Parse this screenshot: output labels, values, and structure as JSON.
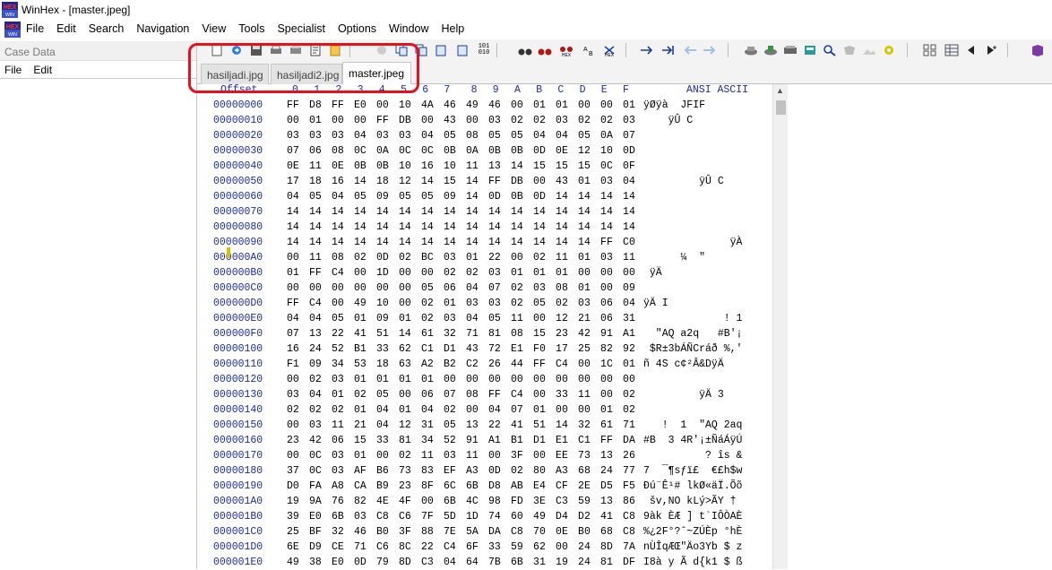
{
  "window": {
    "title": "WinHex - [master.jpeg]"
  },
  "menu": [
    "File",
    "Edit",
    "Search",
    "Navigation",
    "View",
    "Tools",
    "Specialist",
    "Options",
    "Window",
    "Help"
  ],
  "case_panel": {
    "header": "Case Data",
    "submenu": [
      "File",
      "Edit"
    ]
  },
  "tabs": [
    {
      "label": "hasiljadi.jpg",
      "active": false
    },
    {
      "label": "hasiljadi2.jpg",
      "active": false
    },
    {
      "label": "master.jpeg",
      "active": true
    }
  ],
  "hex_header": {
    "offset": "Offset",
    "columns": [
      "0",
      "1",
      "2",
      "3",
      "4",
      "5",
      "6",
      "7",
      "8",
      "9",
      "A",
      "B",
      "C",
      "D",
      "E",
      "F"
    ],
    "ascii": "ANSI ASCII"
  },
  "colors": {
    "offset_text": "#1a2bb8",
    "highlight": "#e8101c"
  },
  "rows": [
    {
      "offset": "00000000",
      "bytes": "FF D8 FF E0 00 10 4A 46 49 46 00 01 01 00 00 01",
      "ascii": "ÿØÿà  JFIF"
    },
    {
      "offset": "00000010",
      "bytes": "00 01 00 00 FF DB 00 43 00 03 02 02 03 02 02 03",
      "ascii": "    ÿÛ C"
    },
    {
      "offset": "00000020",
      "bytes": "03 03 03 04 03 03 04 05 08 05 05 04 04 05 0A 07",
      "ascii": ""
    },
    {
      "offset": "00000030",
      "bytes": "07 06 08 0C 0A 0C 0C 0B 0A 0B 0B 0D 0E 12 10 0D",
      "ascii": ""
    },
    {
      "offset": "00000040",
      "bytes": "0E 11 0E 0B 0B 10 16 10 11 13 14 15 15 15 0C 0F",
      "ascii": ""
    },
    {
      "offset": "00000050",
      "bytes": "17 18 16 14 18 12 14 15 14 FF DB 00 43 01 03 04",
      "ascii": "         ÿÛ C"
    },
    {
      "offset": "00000060",
      "bytes": "04 05 04 05 09 05 05 09 14 0D 0B 0D 14 14 14 14",
      "ascii": ""
    },
    {
      "offset": "00000070",
      "bytes": "14 14 14 14 14 14 14 14 14 14 14 14 14 14 14 14",
      "ascii": ""
    },
    {
      "offset": "00000080",
      "bytes": "14 14 14 14 14 14 14 14 14 14 14 14 14 14 14 14",
      "ascii": ""
    },
    {
      "offset": "00000090",
      "bytes": "14 14 14 14 14 14 14 14 14 14 14 14 14 14 FF C0",
      "ascii": "              ÿÀ"
    },
    {
      "offset": "000000A0",
      "bytes": "00 11 08 02 0D 02 BC 03 01 22 00 02 11 01 03 11",
      "ascii": "      ¼  \""
    },
    {
      "offset": "000000B0",
      "bytes": "01 FF C4 00 1D 00 00 02 02 03 01 01 01 00 00 00",
      "ascii": " ÿÄ"
    },
    {
      "offset": "000000C0",
      "bytes": "00 00 00 00 00 00 05 06 04 07 02 03 08 01 00 09",
      "ascii": ""
    },
    {
      "offset": "000000D0",
      "bytes": "FF C4 00 49 10 00 02 01 03 03 02 05 02 03 06 04",
      "ascii": "ÿÄ I"
    },
    {
      "offset": "000000E0",
      "bytes": "04 04 05 01 09 01 02 03 04 05 11 00 12 21 06 31",
      "ascii": "             ! 1"
    },
    {
      "offset": "000000F0",
      "bytes": "07 13 22 41 51 14 61 32 71 81 08 15 23 42 91 A1",
      "ascii": "  \"AQ a2q   #B'¡"
    },
    {
      "offset": "00000100",
      "bytes": "16 24 52 B1 33 62 C1 D1 43 72 E1 F0 17 25 82 92",
      "ascii": " $R±3bÁÑCráð %,'"
    },
    {
      "offset": "00000110",
      "bytes": "F1 09 34 53 18 63 A2 B2 C2 26 44 FF C4 00 1C 01",
      "ascii": "ñ 4S c¢²Â&DÿÄ"
    },
    {
      "offset": "00000120",
      "bytes": "00 02 03 01 01 01 01 00 00 00 00 00 00 00 00 00",
      "ascii": ""
    },
    {
      "offset": "00000130",
      "bytes": "03 04 01 02 05 00 06 07 08 FF C4 00 33 11 00 02",
      "ascii": "         ÿÄ 3"
    },
    {
      "offset": "00000140",
      "bytes": "02 02 02 01 04 01 04 02 00 04 07 01 00 00 01 02",
      "ascii": ""
    },
    {
      "offset": "00000150",
      "bytes": "00 03 11 21 04 12 31 05 13 22 41 51 14 32 61 71",
      "ascii": "   !  1  \"AQ 2aq"
    },
    {
      "offset": "00000160",
      "bytes": "23 42 06 15 33 81 34 52 91 A1 B1 D1 E1 C1 FF DA",
      "ascii": "#B  3 4R'¡±ÑáÁÿÚ"
    },
    {
      "offset": "00000170",
      "bytes": "00 0C 03 01 00 02 11 03 11 00 3F 00 EE 73 13 26",
      "ascii": "          ? îs &"
    },
    {
      "offset": "00000180",
      "bytes": "37 0C 03 AF B6 73 83 EF A3 0D 02 80 A3 68 24 77",
      "ascii": "7  ¯¶sƒï£  €£h$w"
    },
    {
      "offset": "00000190",
      "bytes": "D0 FA A8 CA B9 23 8F 6C 6B D8 AB E4 CF 2E D5 F5",
      "ascii": "Ðú¨Ê¹# lkØ«äÏ.Õõ"
    },
    {
      "offset": "000001A0",
      "bytes": "19 9A 76 82 4E 4F 00 6B 4C 98 FD 3E C3 59 13 86",
      "ascii": " šv,NO kLý>ÃY †"
    },
    {
      "offset": "000001B0",
      "bytes": "39 E0 6B 03 C8 C6 7F 5D 1D 74 60 49 D4 D2 41 C8",
      "ascii": "9àk ÈÆ ] t`IÔÒAÈ"
    },
    {
      "offset": "000001C0",
      "bytes": "25 BF 32 46 B0 3F 88 7E 5A DA C8 70 0E B0 68 C8",
      "ascii": "%¿2F°?ˆ~ZÚÈp °hÈ"
    },
    {
      "offset": "000001D0",
      "bytes": "6E D9 CE 71 C6 8C 22 C4 6F 33 59 62 00 24 8D 7A",
      "ascii": "nÙÎqÆŒ\"Äo3Yb $ z"
    },
    {
      "offset": "000001E0",
      "bytes": "49 38 E0 0D 79 8D C3 04 64 7B 6B 31 19 24 81 DF",
      "ascii": "I8à y Ã d{k1 $ ß"
    }
  ]
}
